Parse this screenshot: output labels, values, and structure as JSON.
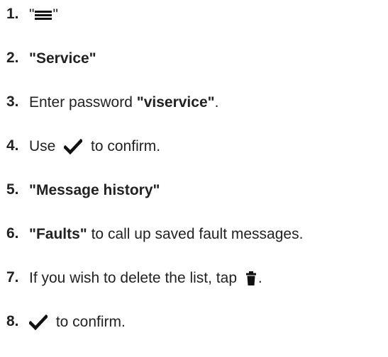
{
  "steps": [
    {
      "num": "1.",
      "pre": "\"",
      "icon": "menu-icon",
      "post": "\""
    },
    {
      "num": "2.",
      "bold": "\"Service\""
    },
    {
      "num": "3.",
      "pre": "Enter password ",
      "bold": "\"viservice\"",
      "post": "."
    },
    {
      "num": "4.",
      "pre": "Use ",
      "icon": "check-icon",
      "post": " to confirm."
    },
    {
      "num": "5.",
      "bold": "\"Message history\""
    },
    {
      "num": "6.",
      "bold": "\"Faults\"",
      "post": " to call up saved fault messages."
    },
    {
      "num": "7.",
      "pre": "If you wish to delete the list, tap ",
      "icon": "trash-icon",
      "post": "."
    },
    {
      "num": "8.",
      "icon": "check-icon",
      "post": " to confirm."
    }
  ]
}
